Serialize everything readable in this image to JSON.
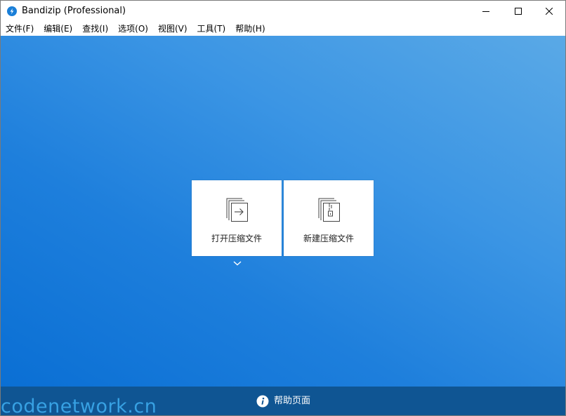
{
  "window": {
    "title": "Bandizip (Professional)"
  },
  "menu": {
    "items": [
      "文件(F)",
      "编辑(E)",
      "查找(I)",
      "选项(O)",
      "视图(V)",
      "工具(T)",
      "帮助(H)"
    ]
  },
  "tiles": {
    "open_label": "打开压缩文件",
    "new_label": "新建压缩文件"
  },
  "footer": {
    "help_label": "帮助页面"
  },
  "watermark": {
    "text": "codenetwork.cn"
  },
  "colors": {
    "gradient_start": "#0a6fd4",
    "gradient_end": "#5aa9e6",
    "footer": "#0f5593",
    "app_icon": "#1a7fd8"
  }
}
